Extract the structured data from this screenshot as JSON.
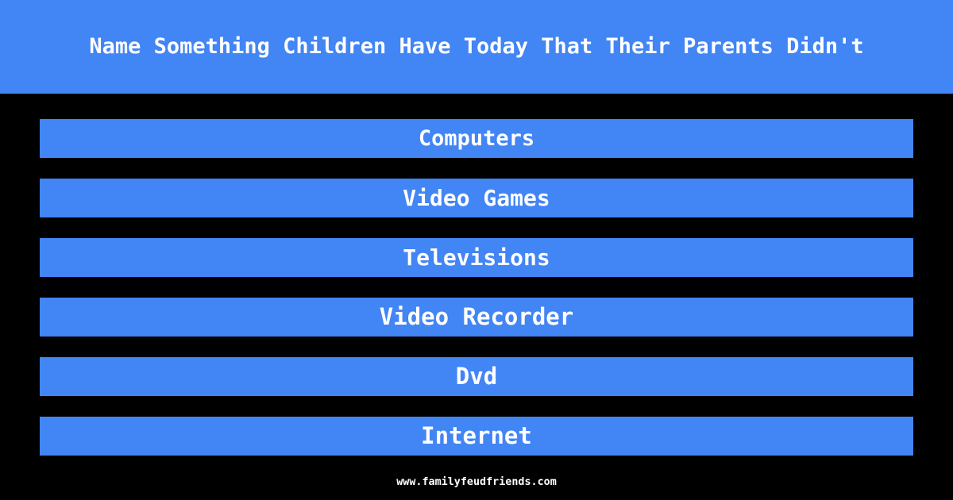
{
  "header": {
    "question": "Name Something Children Have Today That Their Parents Didn't",
    "background_color": "#4285f4",
    "text_color": "#ffffff"
  },
  "answers": {
    "background_color": "#4285f4",
    "text_color": "#ffffff",
    "items": [
      {
        "label": "Computers"
      },
      {
        "label": "Video Games"
      },
      {
        "label": "Televisions"
      },
      {
        "label": "Video Recorder"
      },
      {
        "label": "Dvd"
      },
      {
        "label": "Internet"
      }
    ]
  },
  "footer": {
    "site": "www.familyfeudfriends.com",
    "text_color": "#ffffff"
  },
  "page": {
    "background_color": "#000000"
  }
}
